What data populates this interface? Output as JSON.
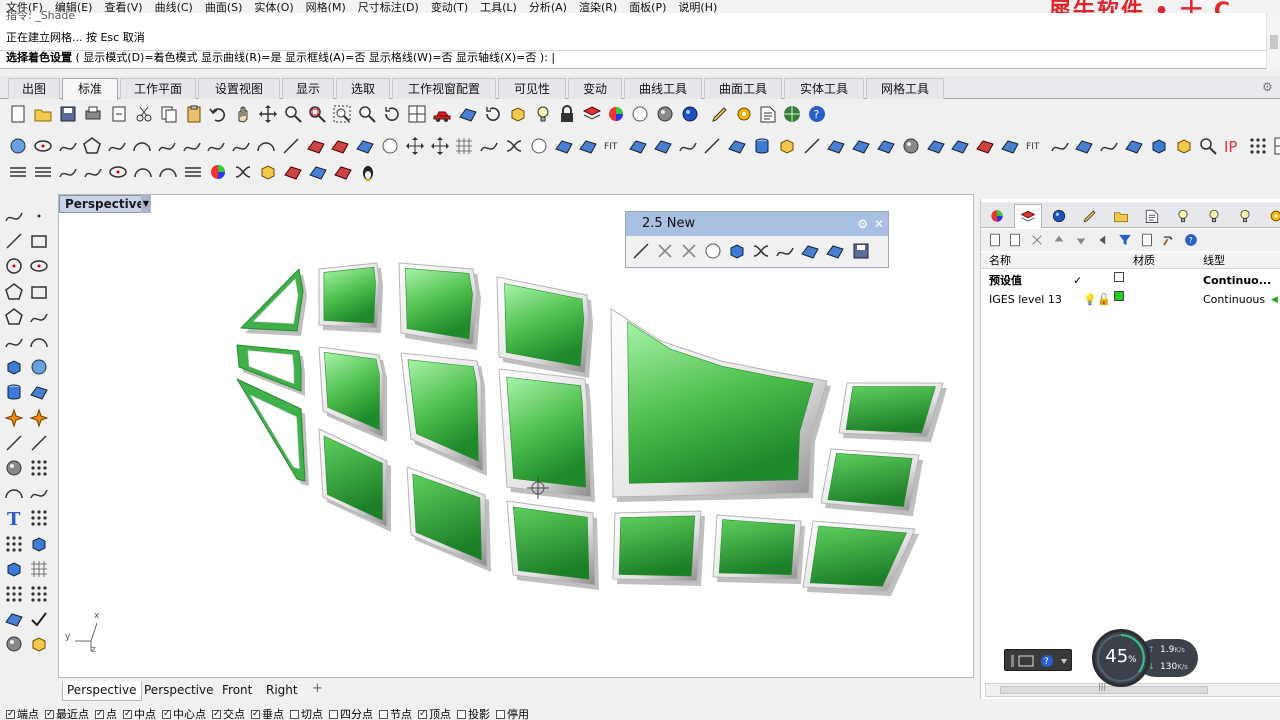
{
  "menu": {
    "items": [
      "文件(F)",
      "编辑(E)",
      "查看(V)",
      "曲线(C)",
      "曲面(S)",
      "实体(O)",
      "网格(M)",
      "尺寸标注(D)",
      "变动(T)",
      "工具(L)",
      "分析(A)",
      "渲染(R)",
      "面板(P)",
      "说明(H)"
    ]
  },
  "brand_text": "犀牛软件 • 十 C",
  "command": {
    "history_line1": "指令: _Shade",
    "history_line2": "正在建立网格... 按 Esc 取消",
    "prompt_label": "选择着色设置",
    "prompt_options": "( 显示模式(D)=着色模式  显示曲线(R)=是  显示框线(A)=否  显示格线(W)=否  显示轴线(X)=否 ):"
  },
  "tabs": [
    "出图",
    "标准",
    "工作平面",
    "设置视图",
    "显示",
    "选取",
    "工作视窗配置",
    "可见性",
    "变动",
    "曲线工具",
    "曲面工具",
    "实体工具",
    "网格工具"
  ],
  "active_tab": "标准",
  "viewport": {
    "title": "Perspective",
    "axis_labels": {
      "x": "x",
      "y": "y",
      "z": "z"
    }
  },
  "float_panel": {
    "title": "2.5 New"
  },
  "view_tabs": [
    "Perspective",
    "Perspective",
    "Front",
    "Right"
  ],
  "active_view_tab": "Perspective",
  "osnaps": [
    {
      "label": "端点",
      "checked": true
    },
    {
      "label": "最近点",
      "checked": true
    },
    {
      "label": "点",
      "checked": true
    },
    {
      "label": "中点",
      "checked": true
    },
    {
      "label": "中心点",
      "checked": true
    },
    {
      "label": "交点",
      "checked": true
    },
    {
      "label": "垂点",
      "checked": true
    },
    {
      "label": "切点",
      "checked": false
    },
    {
      "label": "四分点",
      "checked": false
    },
    {
      "label": "节点",
      "checked": false
    },
    {
      "label": "顶点",
      "checked": true
    },
    {
      "label": "投影",
      "checked": false
    },
    {
      "label": "停用",
      "checked": false
    }
  ],
  "layers_panel": {
    "columns": {
      "name": "名称",
      "material": "材质",
      "linetype": "线型"
    },
    "rows": [
      {
        "name": "预设值",
        "current": "✓",
        "linetype": "Continuo...",
        "color": "#ffffff"
      },
      {
        "name": "IGES level 13",
        "current": "",
        "linetype": "Continuous",
        "color": "#22cc22"
      }
    ]
  },
  "speed_meter": {
    "percent": "45",
    "percent_unit": "%",
    "upload": "1.9",
    "upload_unit": "K/s",
    "download": "130",
    "download_unit": "K/s"
  },
  "colors": {
    "tile_green_dark": "#2f9e3a",
    "tile_green_light": "#a6f0a6",
    "panel_title_blue": "#a9c0e3",
    "viewport_title_blue": "#c9d3e6",
    "brand_red": "#e0262c"
  }
}
